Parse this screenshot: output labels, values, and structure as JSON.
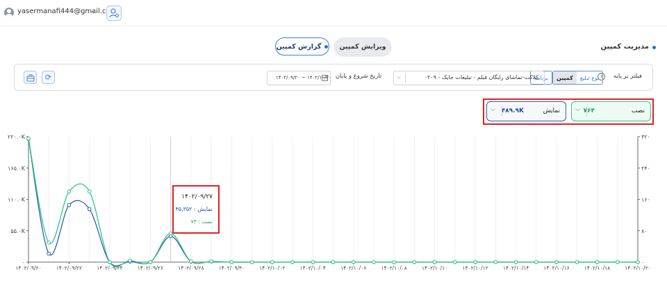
{
  "topbar": {
    "email": "yasermanafi444@gmail.com",
    "caret": "⌄"
  },
  "page_title": "مدیریت کمپین",
  "tabs": {
    "report": "گزارش کمپین",
    "edit": "ویرایش کمپین"
  },
  "filter": {
    "label": "فیلتر بر پایه",
    "seg_left": [
      "نوع تبلیغ",
      "کمپین"
    ],
    "seg_right": "برنامه",
    "campaign": "کلاکت-تماشای رایگان فیلم - تبلیغات جایک - ۰۲۰۹",
    "date_label": "تاریخ شروع و پایان",
    "date_range": "۱۴۰۲/۰۹/۲۰ ~ ۱۴۰۲/۱۰/۲۰"
  },
  "metrics": {
    "install": {
      "label": "نصب",
      "value": "۷۶۴"
    },
    "impression": {
      "label": "نمایش",
      "value": "۴۸۹.۹K"
    }
  },
  "tooltip": {
    "date": "۱۴۰۲/۰۹/۲۷",
    "impression": "نمایش : ۴۵,۳۵۲",
    "install": "نصب : ۷۳"
  },
  "colors": {
    "impression": "#2e5fae",
    "install": "#2dc48d",
    "accent": "#1e6fd9"
  },
  "chart_data": {
    "type": "line",
    "x": [
      "۱۴۰۲/۰۹/۲۰",
      "۱۴۰۲/۰۹/۲۱",
      "۱۴۰۲/۰۹/۲۲",
      "۱۴۰۲/۰۹/۲۳",
      "۱۴۰۲/۰۹/۲۴",
      "۱۴۰۲/۰۹/۲۵",
      "۱۴۰۲/۰۹/۲۶",
      "۱۴۰۲/۰۹/۲۷",
      "۱۴۰۲/۰۹/۲۸",
      "۱۴۰۲/۰۹/۲۹",
      "۱۴۰۲/۰۹/۳۰",
      "۱۴۰۲/۱۰/۰۱",
      "۱۴۰۲/۱۰/۰۲",
      "۱۴۰۲/۱۰/۰۳",
      "۱۴۰۲/۱۰/۰۴",
      "۱۴۰۲/۱۰/۰۵",
      "۱۴۰۲/۱۰/۰۶",
      "۱۴۰۲/۱۰/۰۷",
      "۱۴۰۲/۱۰/۰۸",
      "۱۴۰۲/۱۰/۰۹",
      "۱۴۰۲/۱۰/۱۰",
      "۱۴۰۲/۱۰/۱۱",
      "۱۴۰۲/۱۰/۱۲",
      "۱۴۰۲/۱۰/۱۳",
      "۱۴۰۲/۱۰/۱۴",
      "۱۴۰۲/۱۰/۱۵",
      "۱۴۰۲/۱۰/۱۶",
      "۱۴۰۲/۱۰/۱۷",
      "۱۴۰۲/۱۰/۱۸",
      "۱۴۰۲/۱۰/۱۹",
      "۱۴۰۲/۱۰/۲۰"
    ],
    "x_tick_labels": [
      "۱۴۰۲/۰۹/۲۰",
      "۱۴۰۲/۰۹/۲۲",
      "۱۴۰۲/۰۹/۲۴",
      "۱۴۰۲/۰۹/۲۶",
      "۱۴۰۲/۰۹/۲۸",
      "۱۴۰۲/۰۹/۳۰",
      "۱۴۰۲/۱۰/۰۲",
      "۱۴۰۲/۱۰/۰۴",
      "۱۴۰۲/۱۰/۰۶",
      "۱۴۰۲/۱۰/۰۸",
      "۱۴۰۲/۱۰/۱۰",
      "۱۴۰۲/۱۰/۱۲",
      "۱۴۰۲/۱۰/۱۴",
      "۱۴۰۲/۱۰/۱۶",
      "۱۴۰۲/۱۰/۱۸",
      "۱۴۰۲/۱۰/۲۰"
    ],
    "series": [
      {
        "name": "نمایش",
        "axis": "left",
        "values": [
          216000,
          15000,
          100000,
          93000,
          0,
          1000,
          0,
          45352,
          1000,
          1000,
          0,
          0,
          0,
          0,
          0,
          0,
          0,
          0,
          0,
          0,
          0,
          0,
          0,
          0,
          0,
          0,
          0,
          0,
          0,
          0,
          0
        ]
      },
      {
        "name": "نصب",
        "axis": "right",
        "values": [
          315,
          50,
          180,
          180,
          0,
          4,
          0,
          73,
          2,
          2,
          0,
          0,
          0,
          0,
          0,
          0,
          0,
          0,
          0,
          0,
          0,
          0,
          0,
          0,
          0,
          0,
          0,
          0,
          0,
          0,
          0
        ]
      }
    ],
    "y_left_ticks": [
      "۰",
      "۵۵.۰K",
      "۱۱۰.۰K",
      "۱۶۵.۰K",
      "۲۲۰.۰K"
    ],
    "y_right_ticks": [
      "۰",
      "۸۰",
      "۱۶۰",
      "۲۴۰",
      "۳۲۰"
    ],
    "ylim_left": [
      0,
      220000
    ],
    "ylim_right": [
      0,
      320
    ],
    "highlight_index": 7
  }
}
